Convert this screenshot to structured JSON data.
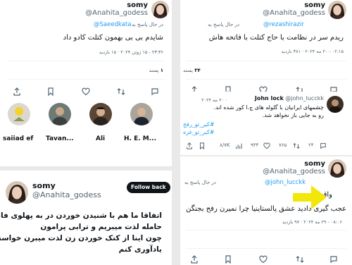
{
  "colors": {
    "accent": "#1d9bf0",
    "muted": "#536471",
    "arrow": "#f3e60a",
    "follow_bg": "#0f1419"
  },
  "panel_tl": {
    "name": "somy",
    "handle": "@Anahita_godess",
    "reply_prefix": "در حال پاسخ به",
    "reply_to": "@Saeedkata",
    "text": "شایدم بی بی بهمون کتلت کادو داد",
    "meta": "۲۳:۳۶ - ۱۵ ژوئن ۲۰۲۴ · ۱۵ بازدید",
    "likes_count": "۱",
    "likes_label": "پسند",
    "action_icons": [
      "comment-icon",
      "retweet-icon",
      "heart-icon",
      "bookmark-icon",
      "share-icon"
    ],
    "suggested_accounts": [
      {
        "name": "saiiad ef"
      },
      {
        "name": "Tavan..."
      },
      {
        "name": "Ali"
      },
      {
        "name": "H. E. M..."
      }
    ]
  },
  "panel_tr": {
    "name": "somy",
    "handle": "@Anahita_godess",
    "reply_prefix": "در حال پاسخ به",
    "reply_to": "@rezashirazir",
    "text": "ریدم سر در نظامت با حاج کتلت با فاتحه هاش",
    "meta": "۰۲:۱۵ - ۲۰ مه ۲۰۲۴ · ۳۸۱ بازدید",
    "likes_count": "۳۴",
    "likes_label": "پسند"
  },
  "panel_mr": {
    "quote_name": "John lock",
    "quote_handle": "@john_lucckk",
    "quote_date": "· ۲۰ مه ۲۰۲۴",
    "quote_text_1": "چشمهای ایرانیان با گلوله های چ.ا کور شده اند.",
    "quote_text_2": "رو به جایی باز نخواهد شد.",
    "hashtag_1": "#کیر_تو_رفح",
    "hashtag_2": "#کیر_تو_غزه",
    "stat_views": "۸/۷K",
    "stat_likes": "۹۳۳",
    "stat_retweets": "۷۶۵",
    "stat_replies": "۲۴"
  },
  "panel_br": {
    "name": "somy",
    "handle": "@Anahita_godess",
    "reply_prefix": "در حال پاسخ به",
    "reply_to": "@john_lucckk",
    "text_1": "واقعا کیر",
    "text_2": "عجب گیری دادید عشق پالستاینیا چرا نمیرن رفح بجنگن",
    "meta": "۰۸:۰۶ - ۲۹ مه ۲۰۲۴ · ۹۷ بازدید"
  },
  "panel_bl": {
    "name": "somy",
    "handle": "@Anahita_godess",
    "follow_label": "Follow back",
    "text_1": "اتفاقا ما هم با شنیدن خوردن در به پهلوی فاطمه",
    "text_2": "حامله لذت میبریم و ترابی پرامون",
    "text_3": "چون اینا از کتک خوردن زن لذت میبرن خواستم",
    "text_4": "یادآوری کنم"
  }
}
